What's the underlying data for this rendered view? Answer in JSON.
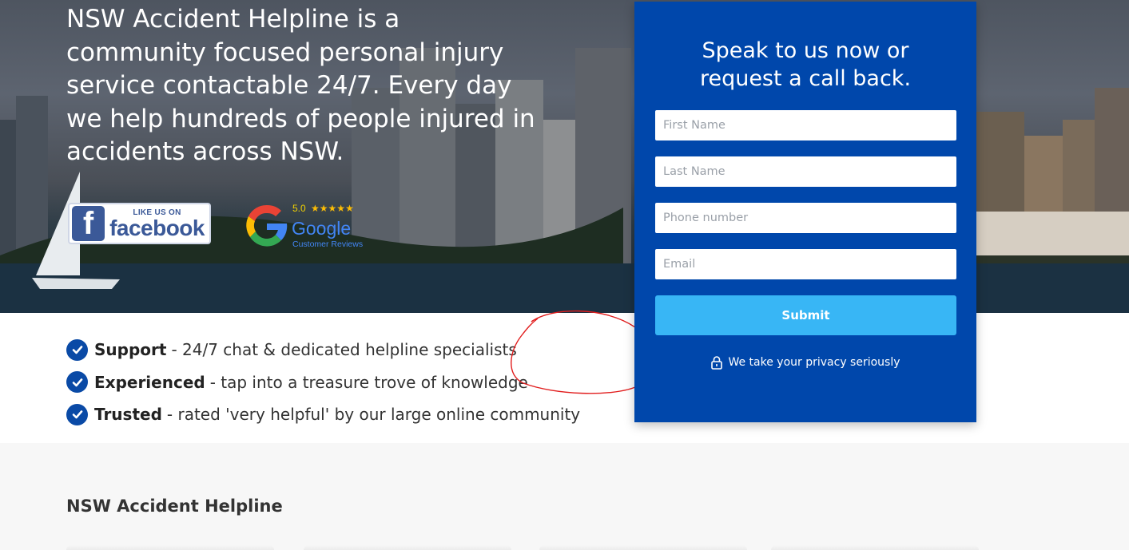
{
  "hero": {
    "text": "NSW Accident Helpline is a community focused personal injury service contactable 24/7. Every day we help hundreds of people injured in accidents across NSW."
  },
  "badges": {
    "facebook": {
      "top": "LIKE US ON",
      "word": "facebook"
    },
    "google": {
      "rating": "5.0",
      "stars": "★★★★★",
      "word": "Google",
      "sub": "Customer Reviews"
    }
  },
  "features": [
    {
      "title": "Support",
      "desc": "- 24/7 chat & dedicated helpline specialists"
    },
    {
      "title": "Experienced",
      "desc": "- tap into a treasure trove of knowledge"
    },
    {
      "title": "Trusted",
      "desc": "- rated 'very helpful' by our large online community"
    }
  ],
  "form": {
    "title_line1": "Speak to us now or",
    "title_line2": "request a call back.",
    "first_name_placeholder": "First Name",
    "last_name_placeholder": "Last Name",
    "phone_placeholder": "Phone number",
    "email_placeholder": "Email",
    "submit_label": "Submit",
    "privacy_text": "We take your privacy seriously"
  },
  "bottom": {
    "title": "NSW Accident Helpline"
  },
  "colors": {
    "form_bg": "#0047ab",
    "submit_bg": "#38b6f5",
    "check_bg": "#0a4aa6",
    "annotation": "#e11d1d"
  }
}
